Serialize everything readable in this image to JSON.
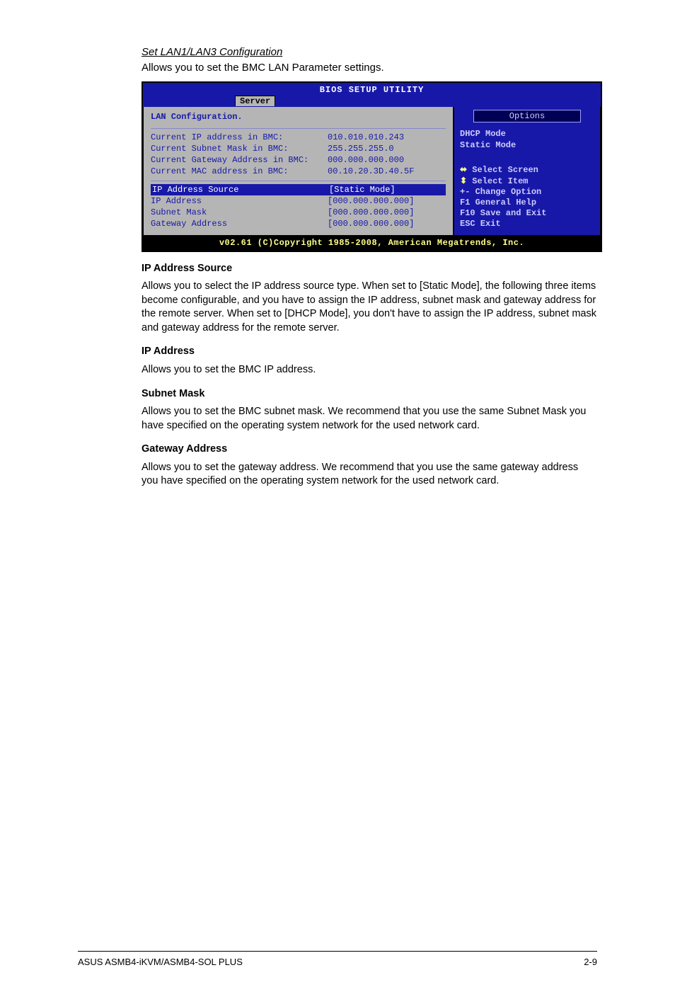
{
  "header": {
    "title": "Set LAN1/LAN3 Configuration",
    "subtitle": "Allows you to set the BMC LAN Parameter settings."
  },
  "bios": {
    "utility_title": "BIOS SETUP UTILITY",
    "tab": "Server",
    "screen_title": "LAN Configuration.",
    "options_label": "Options",
    "fields": {
      "cur_ip_label": "Current IP address in BMC:",
      "cur_ip_val": "010.010.010.243",
      "cur_subnet_label": "Current Subnet Mask in BMC:",
      "cur_subnet_val": "255.255.255.0",
      "cur_gw_label": "Current Gateway Address in BMC:",
      "cur_gw_val": "000.000.000.000",
      "cur_mac_label": "Current MAC address in BMC:",
      "cur_mac_val": "00.10.20.3D.40.5F",
      "ip_src_label": "IP Address Source",
      "ip_src_val": "[Static Mode]",
      "ip_label": "IP Address",
      "ip_val": "[000.000.000.000]",
      "sub_label": "Subnet Mask",
      "sub_val": "[000.000.000.000]",
      "gw_label": "Gateway Address",
      "gw_val": "[000.000.000.000]"
    },
    "right_options": {
      "opt1": "DHCP Mode",
      "opt2": "Static Mode"
    },
    "help": {
      "select_screen": " Select Screen",
      "select_item": "    Select Item",
      "change_option": "+-  Change Option",
      "general_help": "F1  General Help",
      "save_exit": "F10 Save and Exit",
      "esc_exit": "ESC Exit"
    },
    "statusbar": "v02.61 (C)Copyright 1985-2008, American Megatrends, Inc."
  },
  "text": {
    "ip_src_title": "IP Address Source",
    "ip_src_body": "Allows you to select the IP address source type. When set to [Static Mode], the following three items become configurable, and you have to assign the IP address, subnet mask and gateway address for the remote server. When set to [DHCP Mode], you don't have to assign the IP address, subnet mask and gateway address for the remote server.",
    "ip_title": "IP Address",
    "ip_body": "Allows you to set the BMC IP address.",
    "sub_title": "Subnet Mask",
    "sub_body": "Allows you to set the BMC subnet mask. We recommend that you use the same Subnet Mask you have specified on the operating system network for the used network card.",
    "gw_title": "Gateway Address",
    "gw_body": "Allows you to set the gateway address. We recommend that you use the same gateway address you have specified on the operating system network for the used network card."
  },
  "footer": {
    "left": "ASUS ASMB4-iKVM/ASMB4-SOL PLUS",
    "right": "2-9"
  }
}
